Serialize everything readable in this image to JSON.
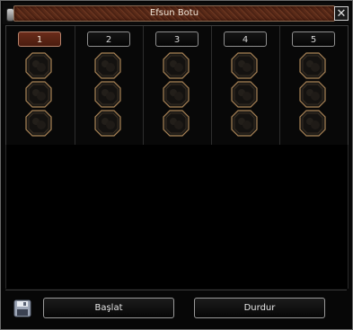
{
  "window": {
    "title": "Efsun Botu",
    "close_label": "✕"
  },
  "slots": {
    "tabs": [
      {
        "label": "1",
        "active": true
      },
      {
        "label": "2",
        "active": false
      },
      {
        "label": "3",
        "active": false
      },
      {
        "label": "4",
        "active": false
      },
      {
        "label": "5",
        "active": false
      }
    ]
  },
  "footer": {
    "save_icon": "floppy-disk-icon",
    "start_label": "Başlat",
    "stop_label": "Durdur"
  },
  "colors": {
    "title_bar": "#5a2a18",
    "active_tab": "#6a2c1a",
    "socket_border": "#a98356"
  }
}
